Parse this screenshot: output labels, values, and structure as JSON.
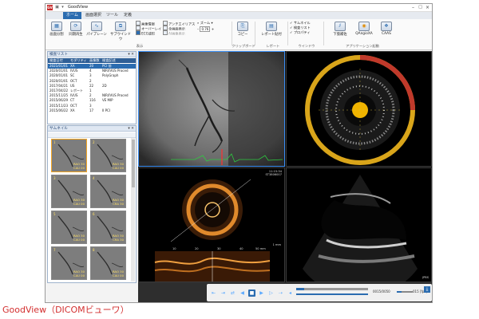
{
  "window": {
    "app_icon": "GV",
    "title": "GoodView",
    "colors": {
      "accent": "#2b6cb0",
      "selection": "#f5a623",
      "caption": "#d32f2f"
    }
  },
  "tabs": [
    {
      "label": "ホーム",
      "active": true
    },
    {
      "label": "画面選択"
    },
    {
      "label": "ツール"
    },
    {
      "label": "定義"
    }
  ],
  "ribbon": {
    "buttons": [
      {
        "label": "画面分割",
        "icon": "grid-icon"
      },
      {
        "label": "同期再生",
        "icon": "sync-icon"
      },
      {
        "label": "パイプレーン",
        "icon": "pipeline-icon"
      },
      {
        "label": "サブウインドウ",
        "icon": "subwindow-icon"
      }
    ],
    "display_small": [
      "画像情報",
      "オーバーレイ",
      "ECG波形"
    ],
    "display_small_2": [
      "アンチエイリアス",
      "全画面表示",
      "AI画像表示"
    ],
    "zoom_label": "ズーム",
    "zoom_value": "0.76",
    "clipboard_label": "コピー",
    "report_label": "レポート貼付",
    "window_items": [
      "サムネイル",
      "検査リスト",
      "プロパティ"
    ],
    "app_buttons": [
      {
        "label": "下肢補佐",
        "icon": "legs-icon"
      },
      {
        "label": "QAngioXA",
        "icon": "qangio-icon"
      },
      {
        "label": "CAAS",
        "icon": "caas-icon"
      }
    ],
    "groups": [
      "表示",
      "クリップボード",
      "レポート",
      "ウインドウ",
      "アプリケーション起動"
    ]
  },
  "exam_list": {
    "title": "検査リスト",
    "columns": [
      "検査日付",
      "モダリティ",
      "画像数",
      "検査記述"
    ],
    "rows": [
      {
        "date": "2021/01/01",
        "mod": "XA",
        "count": "20",
        "desc": "PCI 前",
        "selected": true
      },
      {
        "date": "2020/01/01",
        "mod": "IVUS",
        "count": "4",
        "desc": "NIR/IVUS Proced"
      },
      {
        "date": "2020/01/01",
        "mod": "SC",
        "count": "3",
        "desc": "PolyGraph"
      },
      {
        "date": "2020/01/01",
        "mod": "OCT",
        "count": "2",
        "desc": ""
      },
      {
        "date": "2017/04/21",
        "mod": "US",
        "count": "22",
        "desc": "2D"
      },
      {
        "date": "2017/04/22",
        "mod": "レポート",
        "count": "1",
        "desc": ""
      },
      {
        "date": "2015/11/25",
        "mod": "IVUS",
        "count": "2",
        "desc": "NIR/IVUS Proced"
      },
      {
        "date": "2015/06/29",
        "mod": "CT",
        "count": "116",
        "desc": "VE MIP"
      },
      {
        "date": "2015/11/23",
        "mod": "OCT",
        "count": "3",
        "desc": ""
      },
      {
        "date": "2015/06/22",
        "mod": "XA",
        "count": "17",
        "desc": "II PCI"
      }
    ]
  },
  "thumbnails": {
    "title": "サムネイル",
    "items": [
      {
        "num": "1",
        "label": "RAO 30\nCAU 00",
        "selected": true
      },
      {
        "num": "2",
        "label": "RAO 30\nCAU 00"
      },
      {
        "num": "3",
        "label": "RAO 30\nCAU 00"
      },
      {
        "num": "4",
        "label": "RAO 30\nCRA 30"
      },
      {
        "num": "5",
        "label": "RAO 30\nCAU 00"
      },
      {
        "num": "6",
        "label": "RAO 30\nCRA 30"
      },
      {
        "num": "7",
        "label": "RAO 30\nCAU 00"
      },
      {
        "num": "8",
        "label": "RAO 30\nCAU 00"
      }
    ]
  },
  "viewports": {
    "oct": {
      "overlay_right": "11:15:34\nST3806007",
      "scale": "1 mm",
      "strip_ticks": [
        "10",
        "20",
        "30",
        "40",
        "50 mm"
      ]
    },
    "us": {
      "overlay_right": "JPBS"
    }
  },
  "player": {
    "frame": "0015/0050",
    "fps": "015 [fps]",
    "fps_progress": 0.3
  },
  "caption": "GoodView（DICOMビューワ）"
}
